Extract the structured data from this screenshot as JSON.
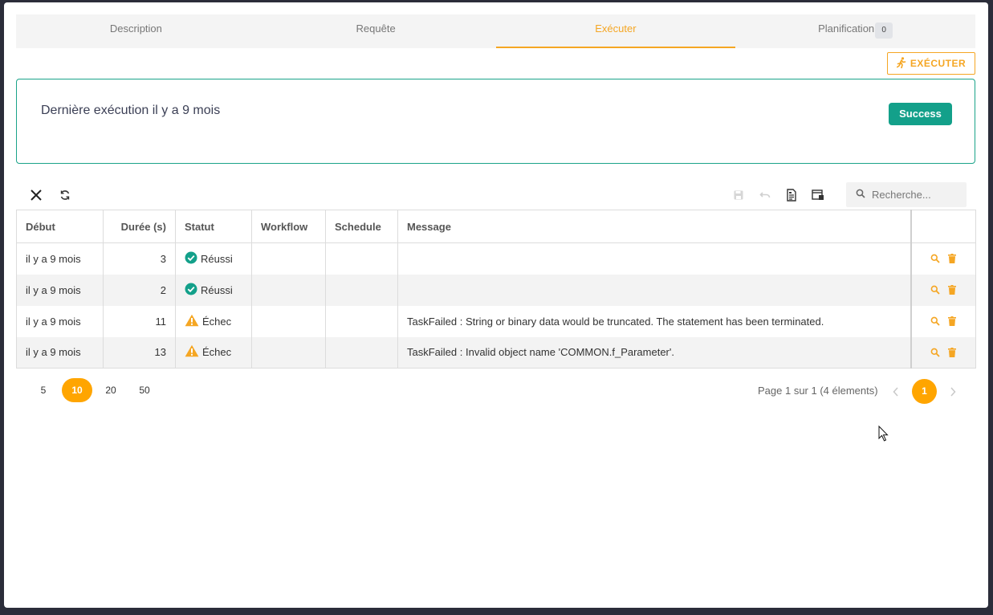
{
  "tabs": [
    {
      "label": "Description"
    },
    {
      "label": "Requête"
    },
    {
      "label": "Exécuter"
    },
    {
      "label": "Planification",
      "badge": "0"
    }
  ],
  "active_tab": "Exécuter",
  "execute_button": {
    "label": "EXÉCUTER",
    "icon": "running-person-icon"
  },
  "panel": {
    "title": "Dernière exécution il y a 9 mois",
    "status": "Success"
  },
  "toolbar": {
    "left_icons": [
      "close-icon",
      "refresh-icon"
    ],
    "right_icons": [
      "save-icon",
      "undo-icon",
      "export-doc-icon",
      "columns-icon"
    ]
  },
  "search": {
    "placeholder": "Recherche..."
  },
  "table": {
    "columns": [
      "Début",
      "Durée (s)",
      "Statut",
      "Workflow",
      "Schedule",
      "Message"
    ],
    "rows": [
      {
        "debut": "il y a 9 mois",
        "duree": "3",
        "statut": "Réussi",
        "status_type": "success",
        "workflow": "",
        "schedule": "",
        "message": ""
      },
      {
        "debut": "il y a 9 mois",
        "duree": "2",
        "statut": "Réussi",
        "status_type": "success",
        "workflow": "",
        "schedule": "",
        "message": ""
      },
      {
        "debut": "il y a 9 mois",
        "duree": "11",
        "statut": "Échec",
        "status_type": "failed",
        "workflow": "",
        "schedule": "",
        "message": "TaskFailed : String or binary data would be truncated. The statement has been terminated."
      },
      {
        "debut": "il y a 9 mois",
        "duree": "13",
        "statut": "Échec",
        "status_type": "failed",
        "workflow": "",
        "schedule": "",
        "message": "TaskFailed : Invalid object name 'COMMON.f_Parameter'."
      }
    ]
  },
  "pagination": {
    "page_sizes": [
      "5",
      "10",
      "20",
      "50"
    ],
    "active_size": "10",
    "info": "Page 1 sur 1 (4 élements)",
    "current_page": "1"
  },
  "colors": {
    "accent": "#ffa500",
    "success": "#13a08a",
    "warning": "#f5a623"
  }
}
